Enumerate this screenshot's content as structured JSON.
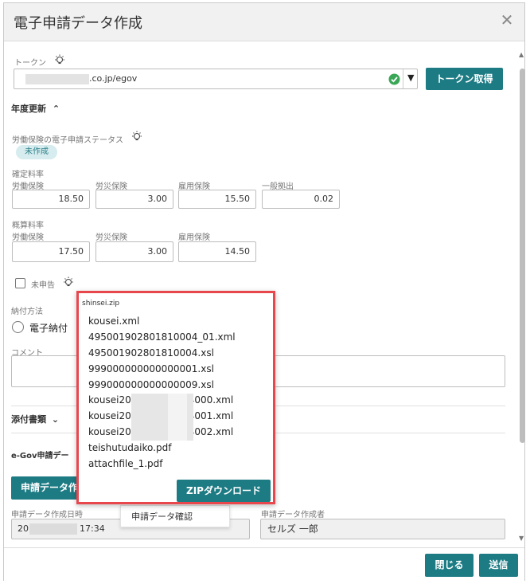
{
  "dialog": {
    "title": "電子申請データ作成"
  },
  "token": {
    "label": "トークン",
    "value": ".co.jp/egov",
    "fetch_button": "トークン取得"
  },
  "nendo": {
    "section_label": "年度更新"
  },
  "labor_status": {
    "label": "労働保険の電子申請ステータス",
    "badge": "未作成"
  },
  "kakutei": {
    "label": "確定料率",
    "fields": [
      {
        "label": "労働保険",
        "value": "18.50"
      },
      {
        "label": "労災保険",
        "value": "3.00"
      },
      {
        "label": "雇用保険",
        "value": "15.50"
      },
      {
        "label": "一般拠出",
        "value": "0.02"
      }
    ]
  },
  "gaisan": {
    "label": "概算料率",
    "fields": [
      {
        "label": "労働保険",
        "value": "17.50"
      },
      {
        "label": "労災保険",
        "value": "3.00"
      },
      {
        "label": "雇用保険",
        "value": "14.50"
      }
    ]
  },
  "unreported": {
    "label": "未申告"
  },
  "payment": {
    "label": "納付方法",
    "option": "電子納付"
  },
  "comment": {
    "label": "コメント"
  },
  "attachments": {
    "label": "添付書類"
  },
  "egov": {
    "label": "e-Gov申請デー",
    "create_button": "申請データ作",
    "created_at_label": "申請データ作成日時",
    "created_at_prefix": "20",
    "created_at_suffix": "17:34",
    "creator_label": "申請データ作成者",
    "creator_value": "セルズ 一郎"
  },
  "confirm_menu": {
    "label": "申請データ確認"
  },
  "zip_popup": {
    "title": "shinsei.zip",
    "files": [
      "kousei.xml",
      "495001902801810004_01.xml",
      "495001902801810004.xsl",
      "999000000000000001.xsl",
      "999000000000000009.xsl",
      "kousei20",
      "4000.xml",
      "kousei20",
      "4001.xml",
      "kousei20",
      "4002.xml",
      "teishutudaiko.pdf",
      "attachfile_1.pdf"
    ],
    "download_button": "ZIPダウンロード"
  },
  "footer": {
    "close_button": "閉じる",
    "send_button": "送信"
  },
  "colors": {
    "accent": "#1d7b84",
    "highlight_border": "#e8474d",
    "status_ok": "#3aa757"
  }
}
